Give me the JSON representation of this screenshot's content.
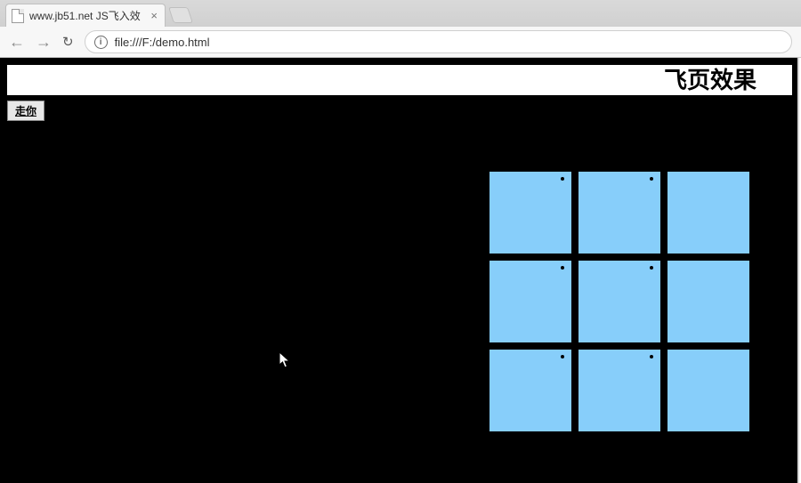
{
  "browser": {
    "tab": {
      "title": "www.jb51.net JS飞入效"
    },
    "url": "file:///F:/demo.html"
  },
  "page": {
    "heading": "飞页效果",
    "button_label": "走你"
  },
  "grid": {
    "rows": 3,
    "cols": 3,
    "tiles": [
      {
        "has_dot": true
      },
      {
        "has_dot": true
      },
      {
        "has_dot": false
      },
      {
        "has_dot": true
      },
      {
        "has_dot": true
      },
      {
        "has_dot": false
      },
      {
        "has_dot": true
      },
      {
        "has_dot": true
      },
      {
        "has_dot": false
      }
    ]
  }
}
